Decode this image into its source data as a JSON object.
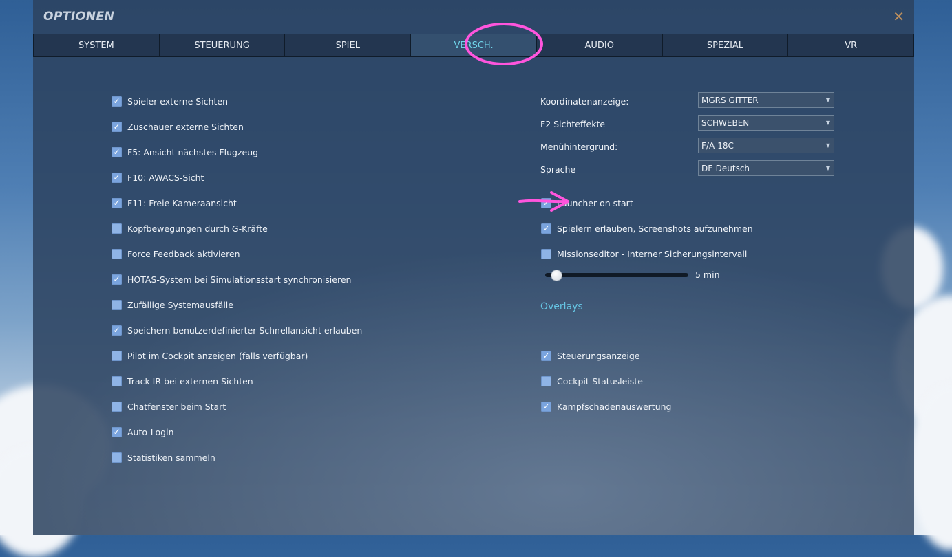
{
  "window": {
    "title": "OPTIONEN",
    "close_icon": "close-icon"
  },
  "tabs": [
    {
      "label": "SYSTEM"
    },
    {
      "label": "STEUERUNG"
    },
    {
      "label": "SPIEL"
    },
    {
      "label": "VERSCH.",
      "active": true
    },
    {
      "label": "AUDIO"
    },
    {
      "label": "SPEZIAL"
    },
    {
      "label": "VR"
    }
  ],
  "left_options": [
    {
      "label": "Spieler externe Sichten",
      "checked": true
    },
    {
      "label": "Zuschauer externe Sichten",
      "checked": true
    },
    {
      "label": "F5: Ansicht nächstes Flugzeug",
      "checked": true
    },
    {
      "label": "F10: AWACS-Sicht",
      "checked": true
    },
    {
      "label": "F11: Freie Kameraansicht",
      "checked": true
    },
    {
      "label": "Kopfbewegungen durch G-Kräfte",
      "checked": false
    },
    {
      "label": "Force Feedback aktivieren",
      "checked": false
    },
    {
      "label": "HOTAS-System bei Simulationsstart synchronisieren",
      "checked": true
    },
    {
      "label": "Zufällige Systemausfälle",
      "checked": false
    },
    {
      "label": "Speichern benutzerdefinierter Schnellansicht erlauben",
      "checked": true
    },
    {
      "label": "Pilot im Cockpit anzeigen (falls verfügbar)",
      "checked": false
    },
    {
      "label": "Track IR bei externen Sichten",
      "checked": false
    },
    {
      "label": "Chatfenster beim Start",
      "checked": false
    },
    {
      "label": "Auto-Login",
      "checked": true
    },
    {
      "label": "Statistiken sammeln",
      "checked": false
    }
  ],
  "selects": [
    {
      "label": "Koordinatenanzeige:",
      "value": "MGRS GITTER"
    },
    {
      "label": "F2 Sichteffekte",
      "value": "SCHWEBEN"
    },
    {
      "label": "Menühintergrund:",
      "value": "F/A-18C"
    },
    {
      "label": "Sprache",
      "value": "DE Deutsch"
    }
  ],
  "right_options": [
    {
      "label": "Launcher on start",
      "checked": true
    },
    {
      "label": "Spielern erlauben, Screenshots aufzunehmen",
      "checked": true
    },
    {
      "label": "Missionseditor - Interner Sicherungsintervall",
      "checked": false
    }
  ],
  "slider": {
    "value_label": "5 min",
    "fraction": 0.0
  },
  "overlays": {
    "title": "Overlays",
    "options": [
      {
        "label": "Steuerungsanzeige",
        "checked": true
      },
      {
        "label": "Cockpit-Statusleiste",
        "checked": false
      },
      {
        "label": "Kampfschadenauswertung",
        "checked": true
      }
    ]
  },
  "annotation_color": "#ff55dd",
  "colors": {
    "active_tab": "#6fd3e8",
    "checkbox": "#7aa4de",
    "close": "#c1915d"
  }
}
